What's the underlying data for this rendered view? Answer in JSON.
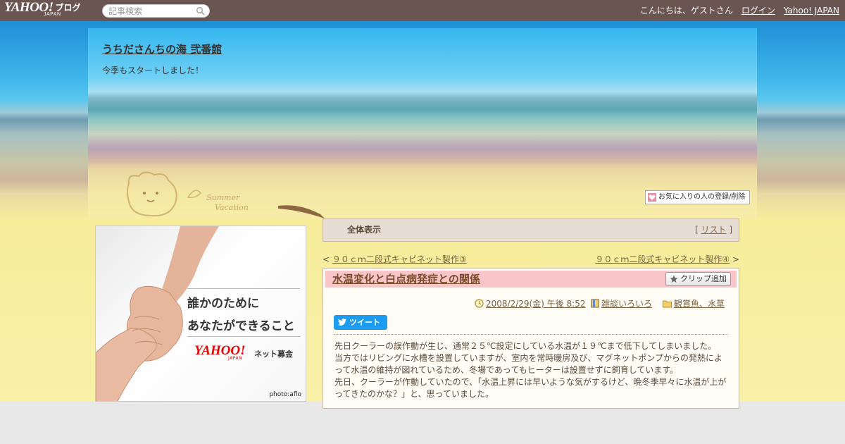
{
  "topbar": {
    "logo": "YAHOO!",
    "logo_sub": "JAPAN",
    "service": "ブログ",
    "search_placeholder": "記事検索",
    "greeting": "こんにちは、ゲストさん",
    "login": "ログイン",
    "yahoo_japan": "Yahoo! JAPAN"
  },
  "header": {
    "title": "うちださんちの海 弐番館",
    "description": "今季もスタートしました！",
    "fav_button": "お気に入りの人の登録/削除"
  },
  "ad": {
    "line1": "誰かのために",
    "line2": "あなたができること",
    "brand": "YAHOO!",
    "brand_sub": "JAPAN",
    "service": "ネット募金",
    "credit": "photo:aflo"
  },
  "viewbar": {
    "label": "全体表示",
    "list_link": "リスト"
  },
  "pager": {
    "prev": "９０ｃｍ二段式キャビネット製作③",
    "next": "９０ｃｍ二段式キャビネット製作④"
  },
  "article": {
    "title": "水温変化と白点病発症との関係",
    "clip_button": "クリップ追加",
    "date": "2008/2/29(金) 午後 8:52",
    "category1": "雑談いろいろ",
    "category2": "観賞魚、水草",
    "tweet_button": "ツイート",
    "paragraphs": [
      "先日クーラーの誤作動が生じ、通常２５℃設定にしている水温が１９℃まで低下してしまいました。",
      "当方ではリビングに水槽を設置していますが、室内を常時暖房及び、マグネットポンプからの発熱によって水温の維持が図れているため、冬場であってもヒーターは設置せずに飼育しています。",
      "先日、クーラーが作動していたので、「水温上昇には早いような気がするけど、晩冬季早々に水温が上がってきたのかな？」と、思っていました。"
    ]
  },
  "colors": {
    "topbar": "#6b5550",
    "title_band": "#f9c5c9",
    "link": "#7a6040",
    "tweet": "#1d9bf0"
  }
}
